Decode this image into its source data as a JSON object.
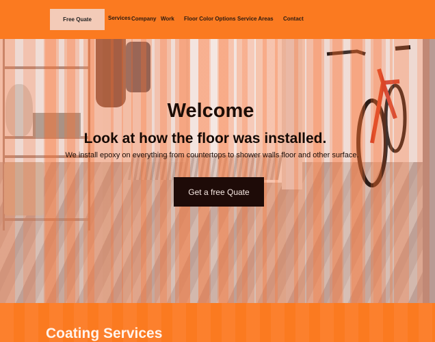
{
  "nav": {
    "cta_label": "Free Quate",
    "links": [
      "Services",
      "Company",
      "Work",
      "Floor Color Options",
      "Service Areas",
      "Contact"
    ]
  },
  "hero": {
    "title": "Welcome",
    "subtitle": "Look at how the floor was installed.",
    "description": "We install epoxy on everything from countertops to shower walls floor and other surface.",
    "cta_label": "Get a free Quate"
  },
  "section": {
    "title": "Coating Services"
  },
  "colors": {
    "brand_orange": "#fb7a20",
    "cta_dark": "#1e0b08",
    "nav_button": "#f3cbb8"
  }
}
